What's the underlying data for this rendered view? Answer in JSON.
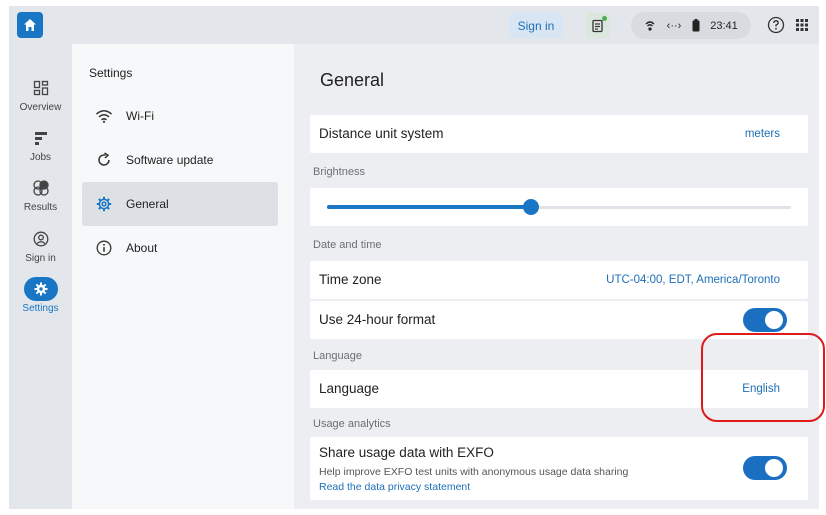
{
  "topbar": {
    "home_icon": "home-icon",
    "signin_label": "Sign in",
    "notes_icon": "notes-icon",
    "status": {
      "link_label": "‹··›",
      "time": "23:41"
    },
    "help_icon": "help-icon",
    "apps_icon": "apps-grid-icon"
  },
  "rail": {
    "items": [
      {
        "label": "Overview",
        "icon": "dashboard-icon"
      },
      {
        "label": "Jobs",
        "icon": "jobs-icon"
      },
      {
        "label": "Results",
        "icon": "results-icon"
      },
      {
        "label": "Sign in",
        "icon": "account-icon"
      },
      {
        "label": "Settings",
        "icon": "gear-icon"
      }
    ]
  },
  "menu": {
    "title": "Settings",
    "items": [
      {
        "label": "Wi-Fi",
        "icon": "wifi-icon"
      },
      {
        "label": "Software update",
        "icon": "refresh-icon"
      },
      {
        "label": "General",
        "icon": "gear-icon"
      },
      {
        "label": "About",
        "icon": "info-icon"
      }
    ],
    "active": "General"
  },
  "main": {
    "title": "General",
    "distance": {
      "label": "Distance unit system",
      "value": "meters"
    },
    "brightness": {
      "section": "Brightness",
      "level": 0.44
    },
    "datetime": {
      "section": "Date and time",
      "timezone_label": "Time zone",
      "timezone_value": "UTC-04:00, EDT, America/Toronto",
      "format_label": "Use 24-hour format",
      "format_on": true
    },
    "language": {
      "section": "Language",
      "label": "Language",
      "value": "English"
    },
    "analytics": {
      "section": "Usage analytics",
      "label": "Share usage data with EXFO",
      "description": "Help improve EXFO test units with anonymous usage data sharing",
      "link": "Read the data privacy statement",
      "enabled": true
    }
  },
  "colors": {
    "accent": "#1976c4",
    "annotation": "#e0191b"
  }
}
